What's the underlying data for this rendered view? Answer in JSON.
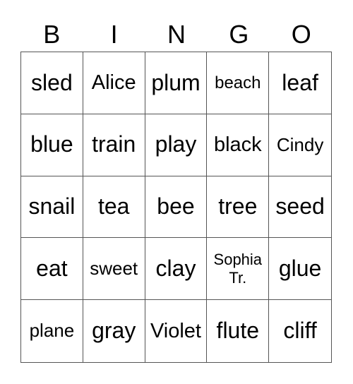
{
  "header": [
    "B",
    "I",
    "N",
    "G",
    "O"
  ],
  "cells": [
    "sled",
    "Alice",
    "plum",
    "beach",
    "leaf",
    "blue",
    "train",
    "play",
    "black",
    "Cindy",
    "snail",
    "tea",
    "bee",
    "tree",
    "seed",
    "eat",
    "sweet",
    "clay",
    "Sophia Tr.",
    "glue",
    "plane",
    "gray",
    "Violet",
    "flute",
    "cliff"
  ]
}
